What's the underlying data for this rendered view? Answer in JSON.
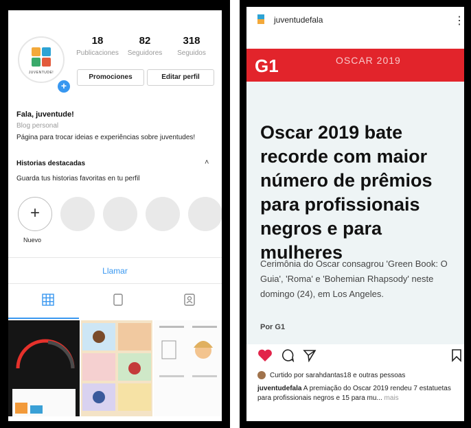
{
  "instagram_profile": {
    "logo_text": "JUVENTUDE!",
    "stats": [
      {
        "value": "18",
        "label": "Publicaciones"
      },
      {
        "value": "82",
        "label": "Seguidores"
      },
      {
        "value": "318",
        "label": "Seguidos"
      }
    ],
    "buttons": {
      "promo": "Promociones",
      "edit": "Editar perfil"
    },
    "name": "Fala, juventude!",
    "category": "Blog personal",
    "bio": "Página para trocar ideias e experiências sobre juventudes!",
    "highlights": {
      "title": "Historias destacadas",
      "subtitle": "Guarda tus historias favoritas en tu perfil",
      "new_label": "Nuevo"
    },
    "call_label": "Llamar"
  },
  "post": {
    "account": "juventudefala",
    "more_icon": "⋮",
    "g1_logo": "G1",
    "section": "OSCAR 2019",
    "headline": "Oscar 2019 bate recorde com maior número de prêmios para profissionais negros e para mulheres",
    "summary": "Cerimônia do Oscar consagrou 'Green Book: O Guia', 'Roma' e 'Bohemian Rhapsody' neste domingo (24), em Los Angeles.",
    "byline": "Por G1",
    "likes_text": "Curtido por sarahdantas18 e outras pessoas",
    "caption_user": "juventudefala",
    "caption_text": " A premiação do Oscar 2019 rendeu 7 estatuetas para profissionais negros e 15 para mu...",
    "caption_more": " mais"
  },
  "colors": {
    "accent": "#3897f0",
    "g1_red": "#e2242b",
    "heart": "#e2244a"
  }
}
